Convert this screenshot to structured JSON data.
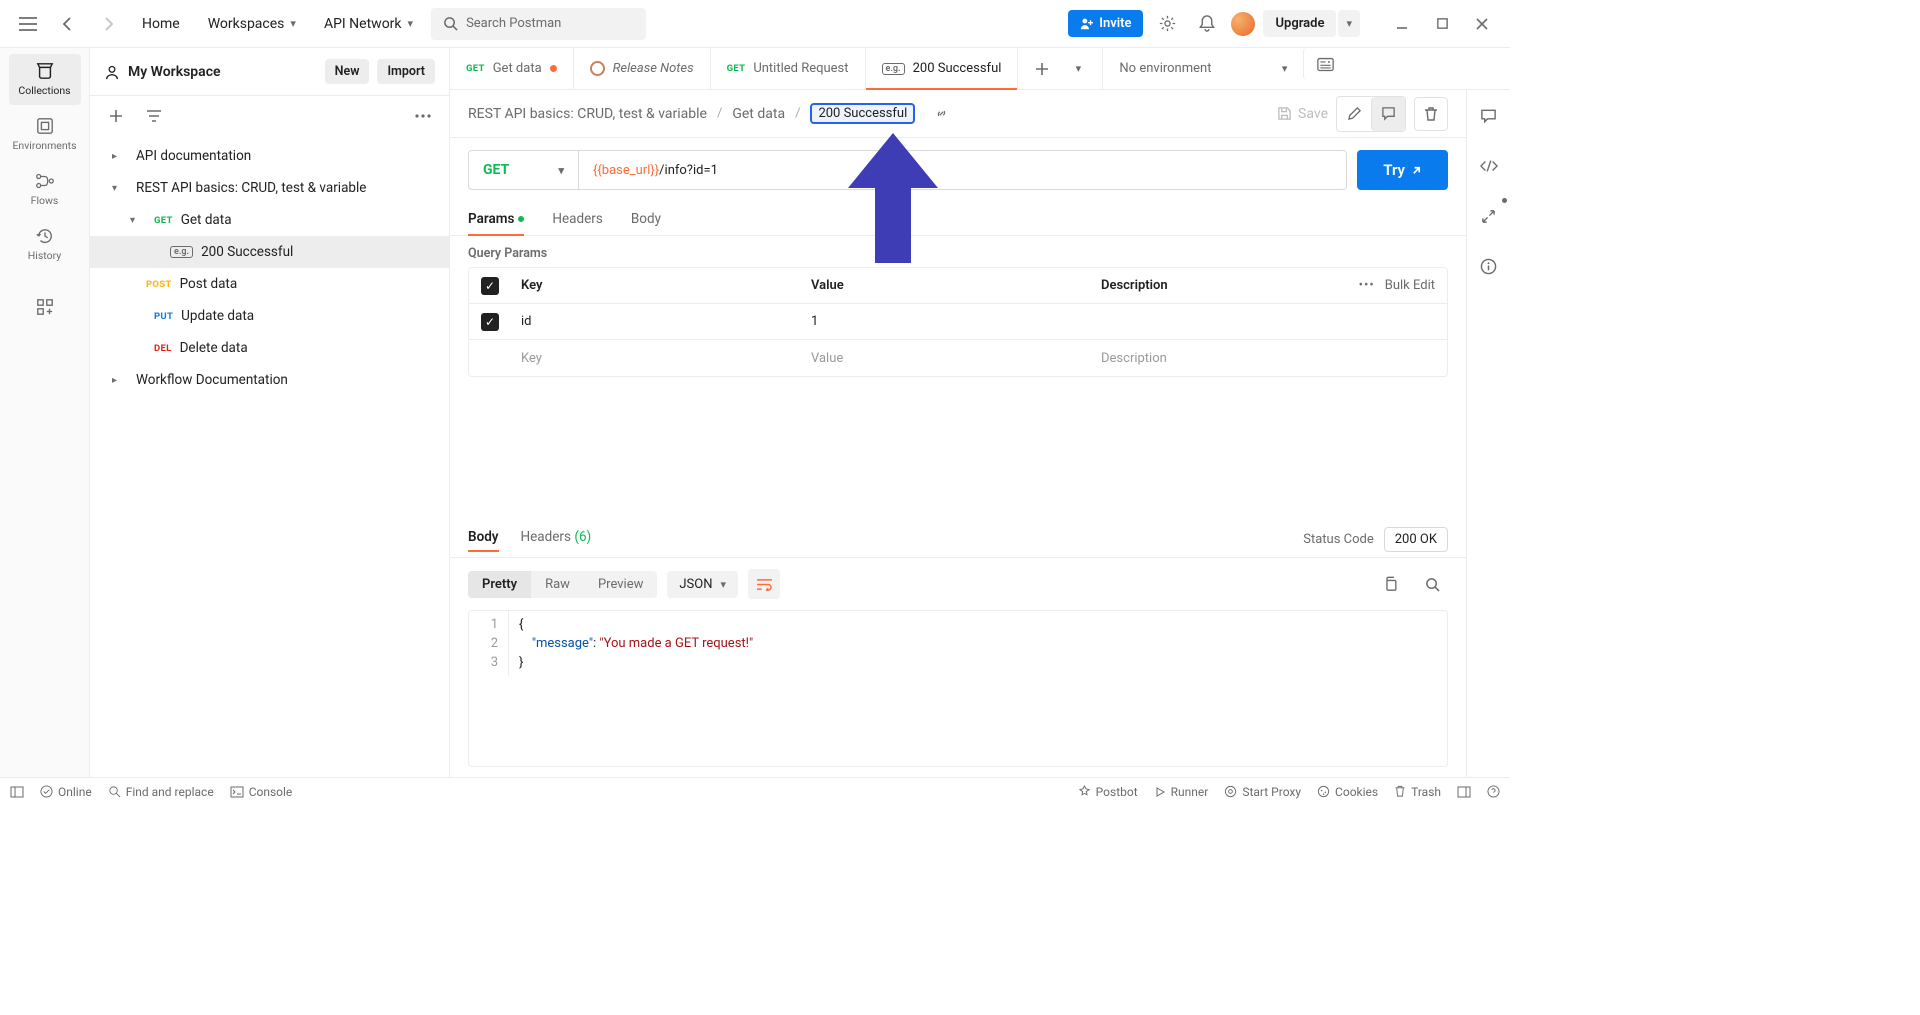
{
  "topnav": {
    "home": "Home",
    "workspaces": "Workspaces",
    "apinetwork": "API Network",
    "search_placeholder": "Search Postman",
    "invite": "Invite",
    "upgrade": "Upgrade"
  },
  "leftcol": {
    "collections": "Collections",
    "environments": "Environments",
    "flows": "Flows",
    "history": "History"
  },
  "workspace": {
    "title": "My Workspace",
    "new": "New",
    "import": "Import"
  },
  "tree": {
    "api_doc": "API documentation",
    "rest_basics": "REST API basics: CRUD, test & variable",
    "get_data": "Get data",
    "success_200": "200 Successful",
    "post_data": "Post data",
    "update_data": "Update data",
    "delete_data": "Delete data",
    "workflow_doc": "Workflow Documentation"
  },
  "method_labels": {
    "get": "GET",
    "post": "POST",
    "put": "PUT",
    "del": "DEL"
  },
  "tabs": {
    "t1": "Get data",
    "t2": "Release Notes",
    "t3": "Untitled Request",
    "t4": "200 Successful",
    "no_env": "No environment"
  },
  "breadcrumb": {
    "root": "REST API basics: CRUD, test & variable",
    "mid": "Get data",
    "leaf": "200 Successful",
    "save": "Save"
  },
  "request": {
    "method": "GET",
    "url_var": "{{base_url}}",
    "url_path": "/info?id=1",
    "try": "Try"
  },
  "subtabs": {
    "params": "Params",
    "headers": "Headers",
    "body": "Body"
  },
  "query": {
    "title": "Query Params",
    "h_key": "Key",
    "h_val": "Value",
    "h_desc": "Description",
    "bulk": "Bulk Edit",
    "rows": [
      {
        "key": "id",
        "value": "1",
        "desc": ""
      }
    ],
    "ph_key": "Key",
    "ph_val": "Value",
    "ph_desc": "Description"
  },
  "response": {
    "tab_body": "Body",
    "tab_headers": "Headers",
    "header_count": "(6)",
    "status_label": "Status Code",
    "status_value": "200 OK",
    "view_pretty": "Pretty",
    "view_raw": "Raw",
    "view_preview": "Preview",
    "fmt": "JSON",
    "json_key": "message",
    "json_val": "You made a GET request!"
  },
  "eg": "e.g.",
  "statusbar": {
    "online": "Online",
    "find": "Find and replace",
    "console": "Console",
    "postbot": "Postbot",
    "runner": "Runner",
    "proxy": "Start Proxy",
    "cookies": "Cookies",
    "trash": "Trash"
  }
}
